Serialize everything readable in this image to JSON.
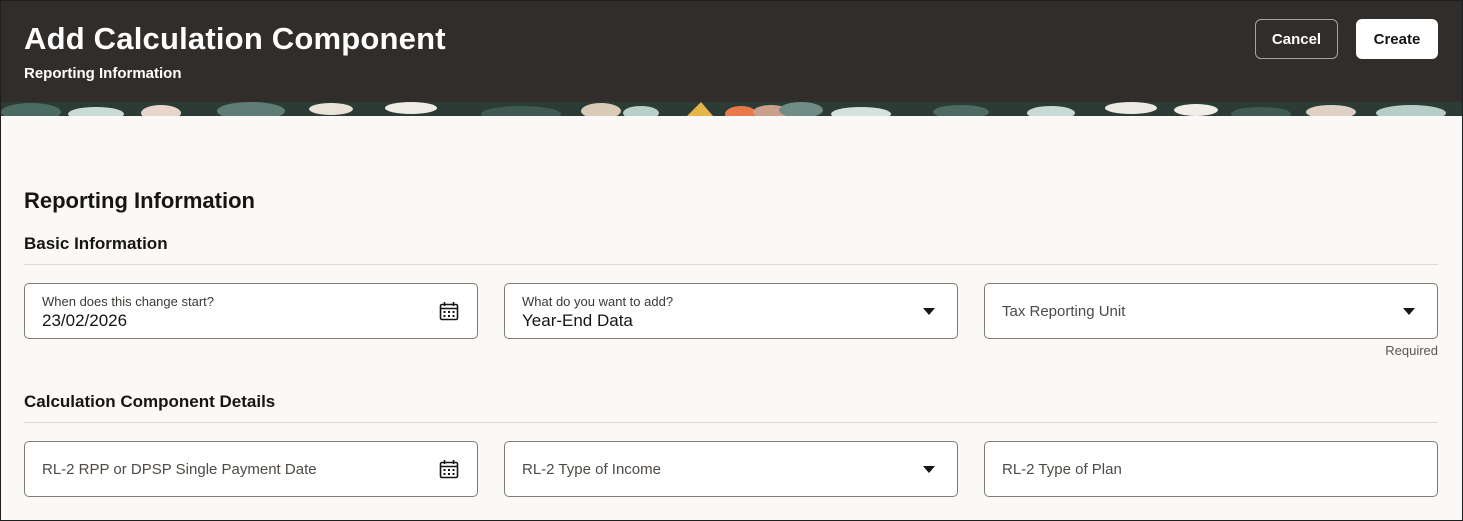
{
  "header": {
    "title": "Add Calculation Component",
    "subtitle": "Reporting Information",
    "cancel_label": "Cancel",
    "create_label": "Create",
    "background_color": "#312d2a"
  },
  "section": {
    "title": "Reporting Information"
  },
  "basic_info": {
    "title": "Basic Information",
    "fields": [
      {
        "label": "When does this change start?",
        "value": "23/02/2026",
        "icon": "calendar-icon"
      },
      {
        "label": "What do you want to add?",
        "value": "Year-End Data",
        "icon": "chevron-down-icon"
      },
      {
        "placeholder": "Tax Reporting Unit",
        "icon": "chevron-down-icon",
        "hint": "Required"
      }
    ]
  },
  "calc_details": {
    "title": "Calculation Component Details",
    "fields": [
      {
        "placeholder": "RL-2 RPP or DPSP Single Payment Date",
        "icon": "calendar-icon"
      },
      {
        "placeholder": "RL-2 Type of Income",
        "icon": "chevron-down-icon"
      },
      {
        "placeholder": "RL-2 Type of Plan"
      }
    ]
  }
}
